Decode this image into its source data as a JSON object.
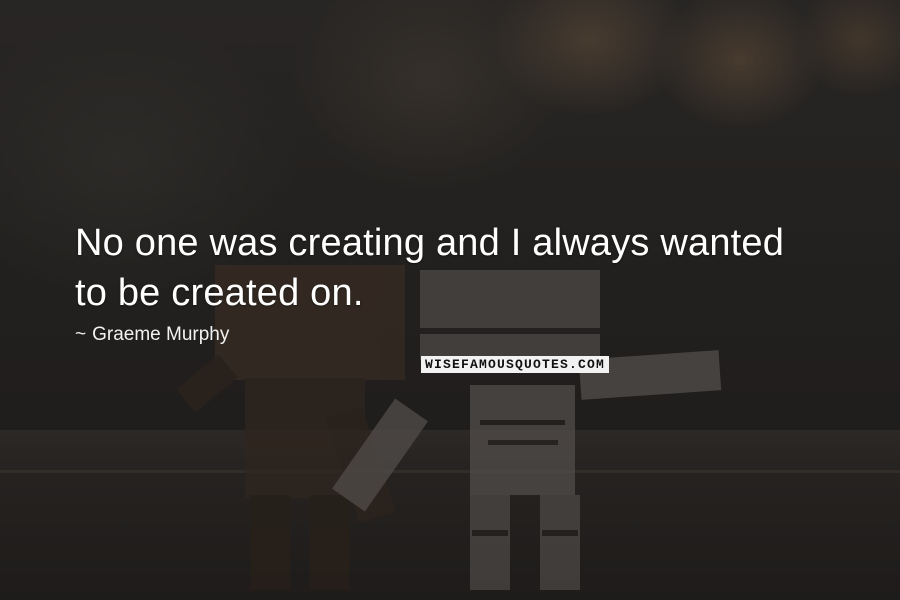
{
  "quote": {
    "line1": "No one was creating and I always wanted",
    "line2": "to be created on.",
    "author_dash": "~",
    "author": "Graeme Murphy"
  },
  "watermark": {
    "text": "WISEFAMOUSQUOTES.COM"
  },
  "colors": {
    "text": "#ffffff",
    "background": "#2a2826"
  }
}
